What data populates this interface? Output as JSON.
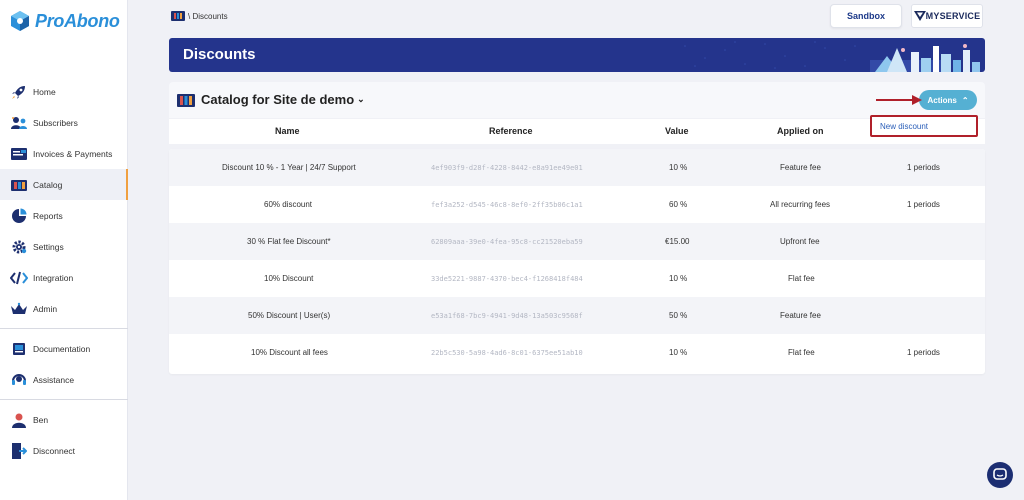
{
  "app": {
    "name": "ProAbono"
  },
  "sidebar": {
    "items": [
      {
        "label": "Home",
        "icon": "rocket-icon"
      },
      {
        "label": "Subscribers",
        "icon": "users-icon"
      },
      {
        "label": "Invoices & Payments",
        "icon": "invoice-icon"
      },
      {
        "label": "Catalog",
        "icon": "catalog-icon",
        "active": true
      },
      {
        "label": "Reports",
        "icon": "pie-chart-icon"
      },
      {
        "label": "Settings",
        "icon": "gear-icon"
      },
      {
        "label": "Integration",
        "icon": "code-icon"
      },
      {
        "label": "Admin",
        "icon": "crown-icon"
      }
    ],
    "help_items": [
      {
        "label": "Documentation",
        "icon": "book-icon"
      },
      {
        "label": "Assistance",
        "icon": "headset-icon"
      }
    ],
    "user_items": [
      {
        "label": "Ben",
        "icon": "user-icon"
      },
      {
        "label": "Disconnect",
        "icon": "door-icon"
      }
    ]
  },
  "breadcrumb": {
    "text": "\\ Discounts"
  },
  "topbar": {
    "sandbox_label": "Sandbox",
    "service_label": "MYSERVICE"
  },
  "banner": {
    "title": "Discounts"
  },
  "catalog": {
    "title": "Catalog for Site de demo"
  },
  "actions": {
    "label": "Actions",
    "menu_item": "New discount"
  },
  "table": {
    "headers": {
      "name": "Name",
      "reference": "Reference",
      "value": "Value",
      "applied_on": "Applied on"
    },
    "rows": [
      {
        "name": "Discount 10 % - 1 Year | 24/7 Support",
        "reference": "4ef903f9-d28f-4228-8442-e8a91ee49e01",
        "value": "10 %",
        "applied_on": "Feature fee",
        "periods": "1 periods"
      },
      {
        "name": "60% discount",
        "reference": "fef3a252-d545-46c8-8ef0-2ff35b06c1a1",
        "value": "60 %",
        "applied_on": "All recurring fees",
        "periods": "1 periods"
      },
      {
        "name": "30 % Flat fee Discount*",
        "reference": "62809aaa-39e0-4fea-95c8-cc21520eba59",
        "value": "€15.00",
        "applied_on": "Upfront fee",
        "periods": ""
      },
      {
        "name": "10% Discount",
        "reference": "33de5221-9887-4370-bec4-f1268418f484",
        "value": "10 %",
        "applied_on": "Flat fee",
        "periods": ""
      },
      {
        "name": "50% Discount | User(s)",
        "reference": "e53a1f68-7bc9-4941-9d48-13a503c9568f",
        "value": "50 %",
        "applied_on": "Feature fee",
        "periods": ""
      },
      {
        "name": "10% Discount all fees",
        "reference": "22b5c530-5a98-4ad6-8c01-6375ee51ab10",
        "value": "10 %",
        "applied_on": "Flat fee",
        "periods": "1 periods"
      }
    ]
  }
}
